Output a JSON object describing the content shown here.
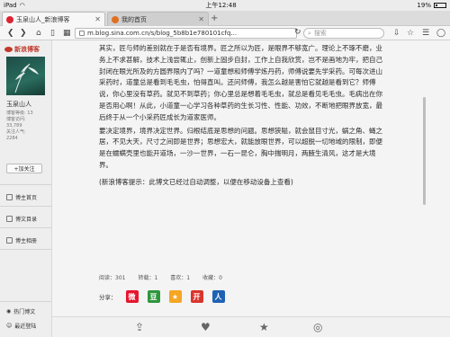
{
  "status": {
    "device": "iPad",
    "time": "上午12:48",
    "battery": "19%"
  },
  "tabs": [
    {
      "title": "玉泉山人_新浪博客",
      "active": true
    },
    {
      "title": "我的首页",
      "active": false
    }
  ],
  "toolbar": {
    "url": "m.blog.sina.com.cn/s/blog_5b8b1e780101cfq...",
    "search_placeholder": "搜索"
  },
  "sidebar": {
    "logo": "新浪博客",
    "user_name": "玉泉山人",
    "stats": [
      "博客等级: 13",
      "博客访问:",
      "33,789",
      "关注人气:",
      "2284"
    ],
    "add_follow": "+加关注",
    "links": [
      "博主首页",
      "博文目录",
      "博主相册"
    ],
    "bottom_links": [
      "热门博文",
      "最近登陆"
    ]
  },
  "article": {
    "paragraphs": [
      "其实，匠与师的差别就在于是否有境界。匠之所以为匠，是眼界不够宽广。理论上不琢不磨，业务上不求甚解，技术上浅尝辄止，创新上固步自封，工作上自我欣赏，岂不是画地为牢，把自己封闭在眼光所及的方圆界限内了吗？一道童想和师傅学炼丹药，师傅说要先学采药。可每次进山采药时，道童总是看到毛毛虫，怕得直叫。还问师傅，我怎么越是害怕它就越是看到它？师傅说，你心里没有草药。就见不到草药；你心里总是想着毛毛虫，就总是看见毛毛虫。毛病出在你是否用心啊！从此，小道童一心学习各种草药的生长习性、性能、功效，不断地把眼界放宽，最后终于从一个小采药匠成长为道家医师。",
      "要决定境界，境界决定世界。归根结底是思想的问题。思想狭隘，就会鼠目寸光，蜗之角、蝇之居，不见大天，尺寸之间即是世界；思想宏大，就能放眼世界，可以超脱一切地域的限制，即便是在蠕螨壳里也能开道场，一沙一世界，一石一昆仑，胸中揣明月，两腋生清风，这才是大境界。"
    ],
    "notice": "(新浪博客提示：此博文已经过自动调整，以便在移动设备上查看)",
    "counts": [
      "阅读：301",
      "转载：1",
      "喜欢：1",
      "收藏：0"
    ],
    "share_label": "分享："
  },
  "share_buttons": [
    {
      "name": "weibo",
      "glyph": "微",
      "color": "#e6162d"
    },
    {
      "name": "douban",
      "glyph": "豆",
      "color": "#2e963d"
    },
    {
      "name": "qzone",
      "glyph": "★",
      "color": "#f5a623"
    },
    {
      "name": "kaixin",
      "glyph": "开",
      "color": "#d9342b"
    },
    {
      "name": "renren",
      "glyph": "人",
      "color": "#1f62b3"
    }
  ],
  "bottom_icons": [
    "share-icon",
    "like-icon",
    "favorite-icon",
    "weibo-icon"
  ]
}
